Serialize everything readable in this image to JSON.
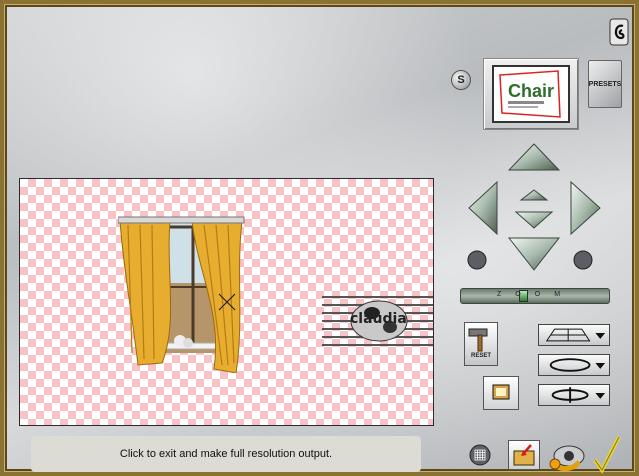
{
  "status": {
    "message": "Click to exit and make full resolution output."
  },
  "preview": {
    "watermark_text": "claudia"
  },
  "toolbar": {
    "s_label": "S",
    "presets_label": "PRESETS",
    "reset_label": "RESET"
  },
  "thumbnail": {
    "text": "Chair"
  },
  "slider": {
    "labels": [
      "Z",
      "O",
      "O",
      "M"
    ],
    "value": 0.42
  },
  "colors": {
    "frame": "#8a7332",
    "checker_pink": "#f7c3c7",
    "curtain": "#e6ad2e",
    "arrow_green": "#b8c8bc",
    "check_yellow": "#e8d23a"
  }
}
